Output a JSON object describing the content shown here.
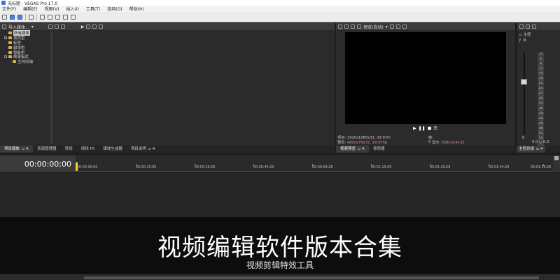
{
  "window": {
    "title": "无标题 - VEGAS Pro 17.0"
  },
  "menu": [
    "文件(F)",
    "编辑(E)",
    "视图(V)",
    "插入(I)",
    "工具(T)",
    "选项(O)",
    "帮助(H)"
  ],
  "project_media": {
    "import_label": "导入媒体...",
    "tree": [
      {
        "label": "所有媒体",
        "selected": true,
        "expand": false
      },
      {
        "label": "按类型",
        "selected": false,
        "expand": true
      },
      {
        "label": "标签",
        "selected": false,
        "expand": false
      },
      {
        "label": "媒体柜",
        "selected": false,
        "expand": false
      },
      {
        "label": "智能柜",
        "selected": false,
        "expand": false
      },
      {
        "label": "故事板库",
        "selected": false,
        "expand": true
      },
      {
        "label": "主时间轴",
        "selected": false,
        "expand": false
      }
    ]
  },
  "left_tabs": [
    {
      "label": "项目媒体",
      "active": true,
      "closable": true
    },
    {
      "label": "资源管理器",
      "active": false,
      "closable": false
    },
    {
      "label": "转场",
      "active": false,
      "closable": false
    },
    {
      "label": "视频 FX",
      "active": false,
      "closable": false
    },
    {
      "label": "媒体生成器",
      "active": false,
      "closable": false
    },
    {
      "label": "项目说明",
      "active": false,
      "closable": true
    }
  ],
  "preview": {
    "quality_label": "预览(自动)",
    "project_label": "项目:",
    "project_value": "1920x1080x32, 29.970i",
    "preview_label": "预览:",
    "preview_value": "480x270x32, 29.970p",
    "frame_label": "帧:",
    "frame_value": "0",
    "display_label": "显示:",
    "display_value": "558x314x32",
    "tabs": [
      {
        "label": "视频预览",
        "active": true,
        "closable": true
      },
      {
        "label": "修剪器",
        "active": false,
        "closable": false
      }
    ]
  },
  "mixer": {
    "master_label": "主控",
    "bus_tab_label": "主控总线",
    "scale": [
      "3",
      "6",
      "9",
      "12",
      "15",
      "18",
      "21",
      "24",
      "27",
      "30",
      "33",
      "36",
      "39",
      "42",
      "45",
      "48",
      "51",
      "54",
      "57"
    ],
    "left_level": "0.0",
    "right_level": "0.0",
    "bottom_value": "0"
  },
  "timeline": {
    "timecode": "00:00:00;00",
    "ruler": [
      "00:00:00;00",
      "00:00:15;00",
      "00:00:29;29",
      "00:00:44;29",
      "00:00:59;28",
      "00:01:15;00",
      "00:01:29;29",
      "00:01:44;29",
      "00:01:59;28"
    ]
  },
  "overlay": {
    "title": "视频编辑软件版本合集",
    "subtitle": "视频剪辑特效工具"
  }
}
